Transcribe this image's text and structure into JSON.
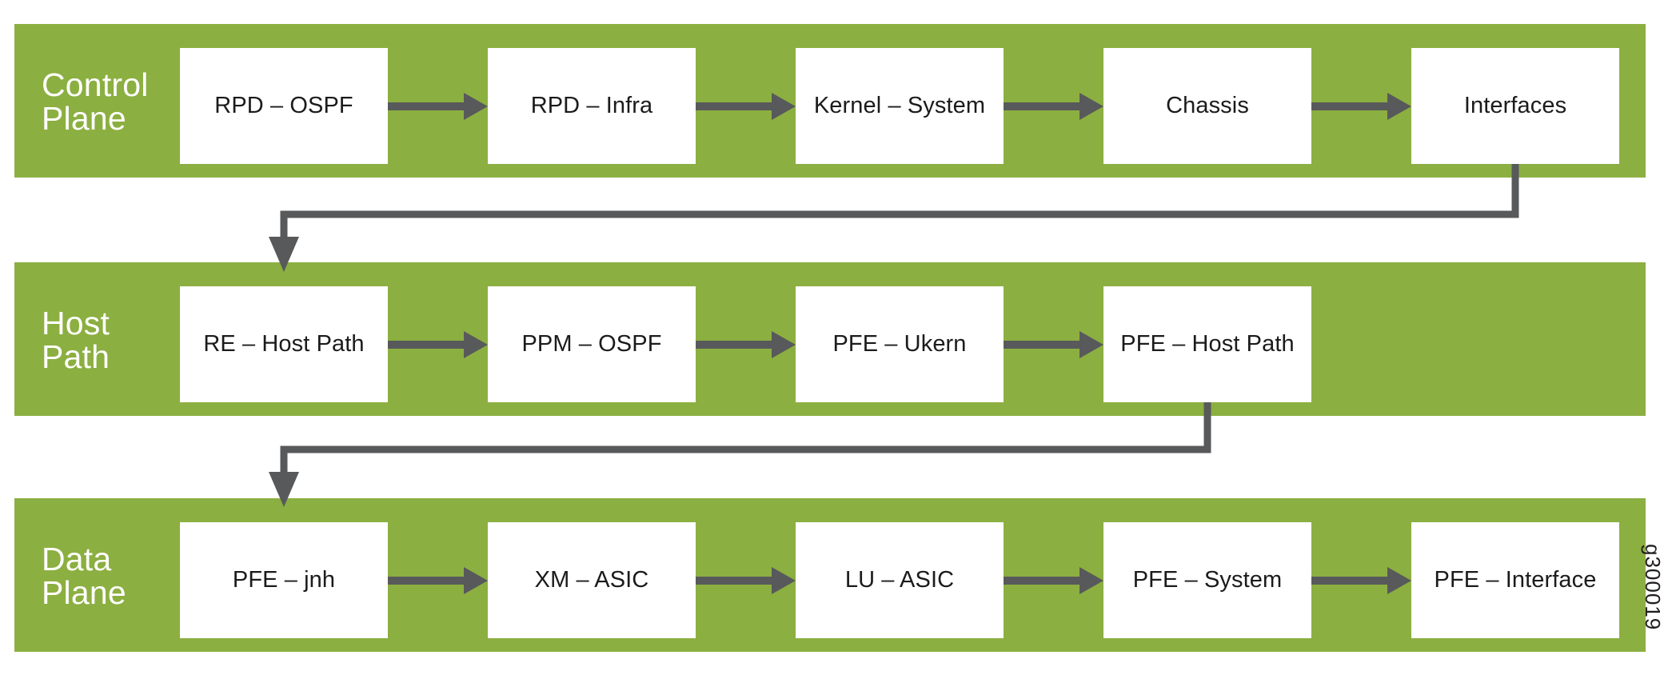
{
  "figure": {
    "id_label": "g300019",
    "colors": {
      "band_green": "#8CAF41",
      "node_fill": "#FFFFFF",
      "arrow_gray": "#58595B",
      "band_label_text": "#FFFFFF",
      "node_text": "#1B1B1B",
      "background": "#FFFFFF"
    }
  },
  "rows": [
    {
      "label": "Control\nPlane",
      "nodes": [
        {
          "label": "RPD – OSPF"
        },
        {
          "label": "RPD – Infra"
        },
        {
          "label": "Kernel – System"
        },
        {
          "label": "Chassis"
        },
        {
          "label": "Interfaces"
        }
      ]
    },
    {
      "label": "Host\nPath",
      "nodes": [
        {
          "label": "RE – Host Path"
        },
        {
          "label": "PPM – OSPF"
        },
        {
          "label": "PFE – Ukern"
        },
        {
          "label": "PFE – Host Path"
        }
      ]
    },
    {
      "label": "Data\nPlane",
      "nodes": [
        {
          "label": "PFE – jnh"
        },
        {
          "label": "XM – ASIC"
        },
        {
          "label": "LU – ASIC"
        },
        {
          "label": "PFE – System"
        },
        {
          "label": "PFE – Interface"
        }
      ]
    }
  ],
  "flow": {
    "row1_sequence": [
      "RPD – OSPF",
      "RPD – Infra",
      "Kernel – System",
      "Chassis",
      "Interfaces"
    ],
    "row2_sequence": [
      "RE – Host Path",
      "PPM – OSPF",
      "PFE – Ukern",
      "PFE – Host Path"
    ],
    "row3_sequence": [
      "PFE – jnh",
      "XM – ASIC",
      "LU – ASIC",
      "PFE – System",
      "PFE – Interface"
    ],
    "cross_links": [
      {
        "from": "Interfaces",
        "to": "RE – Host Path"
      },
      {
        "from": "PFE – Host Path",
        "to": "PFE – jnh"
      }
    ]
  }
}
